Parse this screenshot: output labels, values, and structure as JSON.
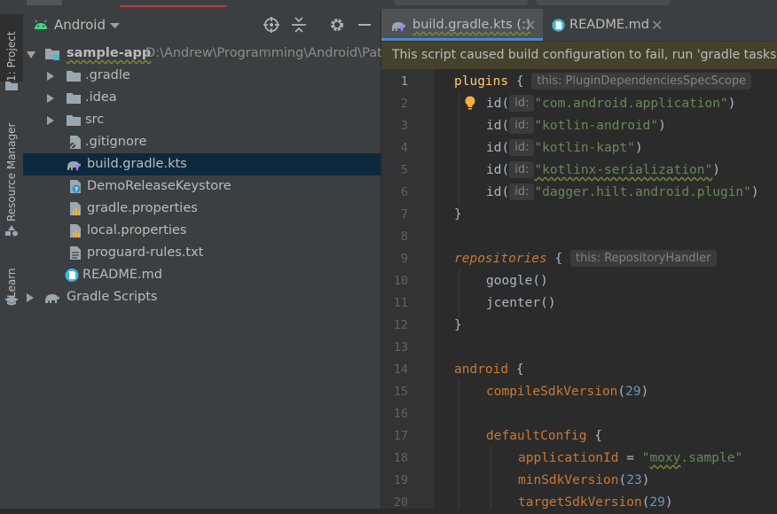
{
  "sidebar_tabs": [
    {
      "label": "1: Project",
      "icon": "folder-icon"
    },
    {
      "label": "Resource Manager",
      "icon": "resource-manager-icon"
    },
    {
      "label": "Learn",
      "icon": "learn-icon"
    }
  ],
  "project_panel": {
    "view_selector": "Android",
    "tree": [
      {
        "label": "sample-app",
        "path": "D:\\Andrew\\Programming\\Android\\Patte",
        "icon": "module-folder-icon",
        "level": 0,
        "expanded": true
      },
      {
        "label": ".gradle",
        "icon": "folder-icon",
        "level": 1,
        "collapsed": true
      },
      {
        "label": ".idea",
        "icon": "folder-icon",
        "level": 1,
        "collapsed": true
      },
      {
        "label": "src",
        "icon": "folder-icon",
        "level": 1,
        "collapsed": true
      },
      {
        "label": ".gitignore",
        "icon": "gitignore-file-icon",
        "level": 1
      },
      {
        "label": "build.gradle.kts",
        "icon": "gradle-kts-file-icon",
        "level": 1,
        "selected": true
      },
      {
        "label": "DemoReleaseKeystore",
        "icon": "unknown-file-icon",
        "level": 1
      },
      {
        "label": "gradle.properties",
        "icon": "properties-file-icon",
        "level": 1
      },
      {
        "label": "local.properties",
        "icon": "properties-file-icon",
        "level": 1
      },
      {
        "label": "proguard-rules.txt",
        "icon": "text-file-icon",
        "level": 1
      },
      {
        "label": "README.md",
        "icon": "markdown-file-icon",
        "level": 1
      },
      {
        "label": "Gradle Scripts",
        "icon": "gradle-elephant-icon",
        "level": 0,
        "collapsed": true
      }
    ]
  },
  "editor": {
    "tabs": [
      {
        "label": "build.gradle.kts (:)",
        "icon": "gradle-kts-file-icon",
        "active": true
      },
      {
        "label": "README.md",
        "icon": "markdown-file-icon",
        "active": false
      }
    ],
    "banner": "This script caused build configuration to fail, run 'gradle tasks' for",
    "line_numbers": [
      "1",
      "2",
      "3",
      "4",
      "5",
      "6",
      "7",
      "8",
      "9",
      "10",
      "11",
      "12",
      "13",
      "14",
      "15",
      "16",
      "17",
      "18",
      "19",
      "20"
    ],
    "hints": {
      "plugins": "this: PluginDependenciesSpecScope",
      "repositories": "this: RepositoryHandler",
      "id": "id:"
    },
    "code": {
      "l1_kw": "plugins",
      "l1_brace": "{",
      "id_fn": "id(",
      "l2_str": "\"com.android.application\"",
      "l3_str": "\"kotlin-android\"",
      "l4_str": "\"kotlin-kapt\"",
      "l5_str": "\"kotlinx-serialization\"",
      "l6_str": "\"dagger.hilt.android.plugin\"",
      "close_paren": ")",
      "close_brace": "}",
      "l9_kw": "repositories",
      "l9_brace": "{",
      "l10": "google()",
      "l11": "jcenter()",
      "l14_kw": "android",
      "l14_brace": "{",
      "l15_kw": "compileSdkVersion",
      "l15_open": "(",
      "l15_num": "29",
      "l17_kw": "defaultConfig",
      "l17_brace": "{",
      "l18_kw": "applicationId",
      "l18_eq": " = ",
      "l18_str_open": "\"",
      "l18_str_val": "moxy",
      "l18_str_rest": ".sample\"",
      "l19_kw": "minSdkVersion",
      "l19_num": "23",
      "l20_kw": "targetSdkVersion",
      "l20_num": "29"
    }
  },
  "colors": {
    "keyword": "#cc7832",
    "string": "#6a8759",
    "number": "#6897bb",
    "accent": "#4a88c7",
    "selection": "#0d293e"
  }
}
